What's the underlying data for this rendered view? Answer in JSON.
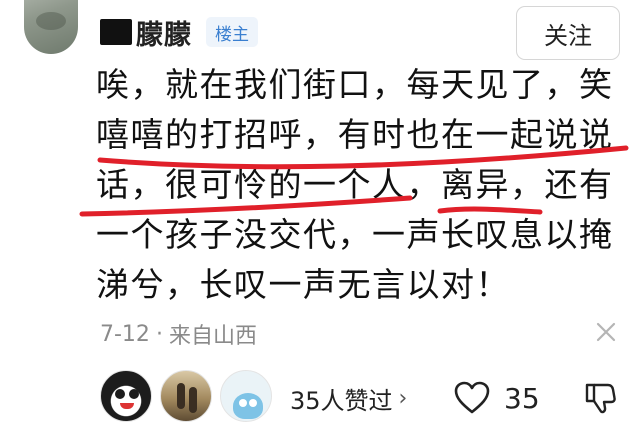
{
  "author": {
    "name": "朦朦",
    "badge": "楼主",
    "follow_label": "关注"
  },
  "comment": {
    "lines": [
      "唉，就在我们街口，每天见了，笑",
      "嘻嘻的打招呼，有时也在一起说说",
      "话，很可怜的一个人，离异，还有",
      "一个孩子没交代，一声长叹息以掩",
      "涕兮，长叹一声无言以对！"
    ]
  },
  "meta": {
    "date": "7-12",
    "separator": "·",
    "location": "来自山西"
  },
  "likes": {
    "summary": "35人赞过",
    "chevron": "›",
    "count": "35"
  },
  "annotation": {
    "stroke_color": "#e0202a"
  },
  "icons": {
    "close": "close-icon",
    "heart": "heart-icon",
    "dislike": "thumbs-down-icon"
  }
}
